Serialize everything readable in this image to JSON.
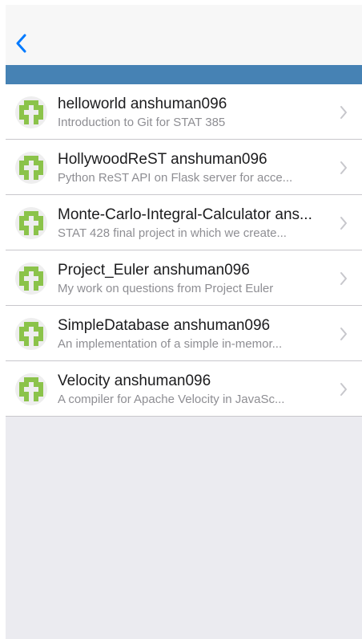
{
  "nav": {
    "back_icon": "chevron-left-icon"
  },
  "colors": {
    "accent": "#007aff",
    "header_bar": "#4682b4",
    "avatar_green": "#8bc34a"
  },
  "repos": [
    {
      "title": "helloworld anshuman096",
      "subtitle": "Introduction to Git for STAT 385"
    },
    {
      "title": "HollywoodReST anshuman096",
      "subtitle": "Python ReST API on Flask server for acce..."
    },
    {
      "title": "Monte-Carlo-Integral-Calculator ans...",
      "subtitle": "STAT 428 final project in which we create..."
    },
    {
      "title": "Project_Euler anshuman096",
      "subtitle": "My work on questions from Project Euler"
    },
    {
      "title": "SimpleDatabase anshuman096",
      "subtitle": "An implementation of a simple in-memor..."
    },
    {
      "title": "Velocity anshuman096",
      "subtitle": "A compiler for Apache Velocity in JavaSc..."
    }
  ]
}
